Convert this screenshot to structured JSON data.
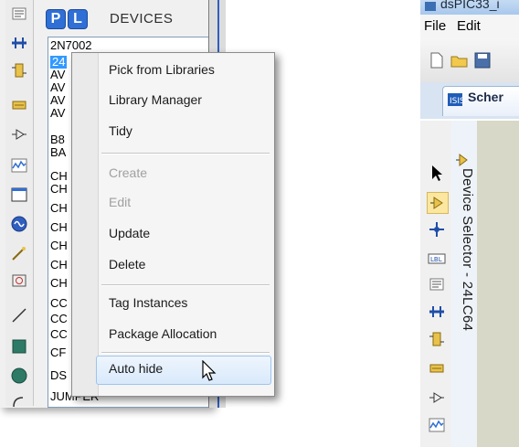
{
  "left_panel": {
    "p_button": "P",
    "l_button": "L",
    "devices_title": "DEVICES",
    "device_list": [
      "2N7002",
      "24",
      "AV",
      "AV",
      "AV",
      "AV",
      "B8",
      "BA",
      "CH",
      "CH",
      "CH",
      "CH",
      "CH",
      "CH",
      "CH",
      "CC",
      "CC",
      "CC",
      "CF",
      "DS",
      "JUMPER"
    ]
  },
  "context_menu": {
    "items": [
      {
        "label": "Pick from Libraries",
        "enabled": true
      },
      {
        "label": "Library Manager",
        "enabled": true
      },
      {
        "label": "Tidy",
        "enabled": true
      },
      {
        "label": "Create",
        "enabled": false
      },
      {
        "label": "Edit",
        "enabled": false
      },
      {
        "label": "Update",
        "enabled": true
      },
      {
        "label": "Delete",
        "enabled": true
      },
      {
        "label": "Tag Instances",
        "enabled": true
      },
      {
        "label": "Package Allocation",
        "enabled": true
      },
      {
        "label": "Auto hide",
        "enabled": true,
        "highlighted": true
      }
    ]
  },
  "right_panel": {
    "window_title": "dsPIC33_i",
    "menu": {
      "file": "File",
      "edit": "Edit"
    },
    "tab_label": "Scher",
    "vertical_label": "Device Selector - 24LC64"
  },
  "colors": {
    "accent": "#2f6fd6",
    "selection": "#3399ff",
    "hover": "#d9e9fb"
  }
}
